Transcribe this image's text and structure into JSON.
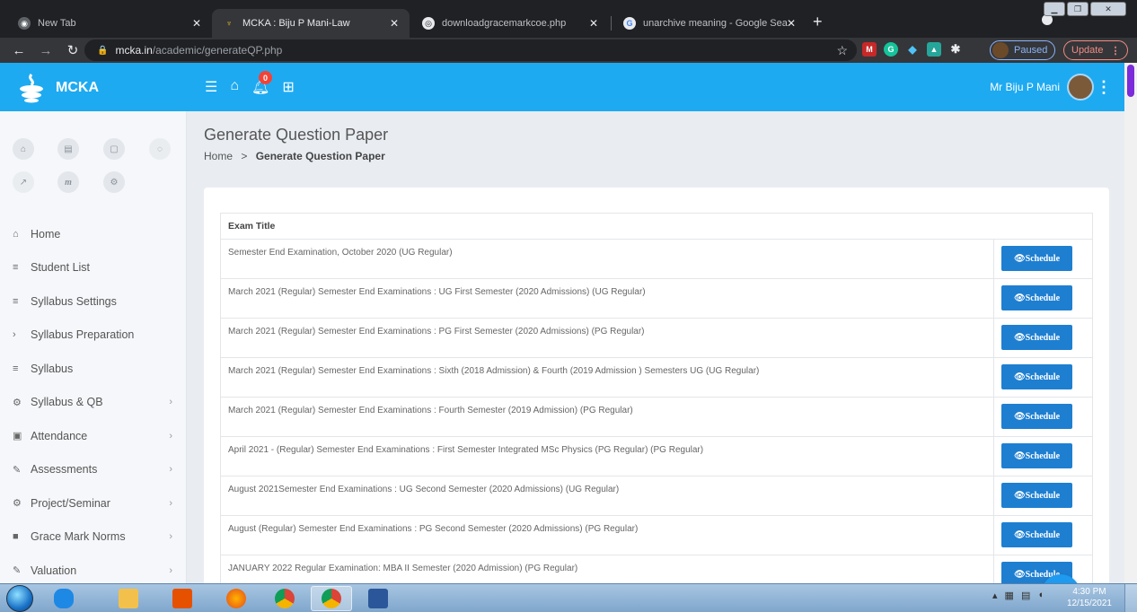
{
  "browser": {
    "tabs": [
      {
        "title": "New Tab",
        "favicon": "chrome-icon"
      },
      {
        "title": "MCKA : Biju P Mani-Law",
        "favicon": "mcka-logo-icon"
      },
      {
        "title": "downloadgracemarkcoe.php",
        "favicon": "globe-icon"
      },
      {
        "title": "unarchive meaning - Google Sea",
        "favicon": "google-icon"
      }
    ],
    "new_tab_label": "+",
    "url_host": "mcka.in",
    "url_path": "/academic/generateQP.php",
    "profile_label": "Paused",
    "update_label": "Update"
  },
  "header": {
    "brand": "MCKA",
    "notification_count": "0",
    "user_name": "Mr Biju P Mani"
  },
  "sidebar": {
    "menu": [
      {
        "label": "Home",
        "icon": "home-icon",
        "glyph": "⌂",
        "chevron": false
      },
      {
        "label": "Student List",
        "icon": "list-icon",
        "glyph": "≡",
        "chevron": false
      },
      {
        "label": "Syllabus Settings",
        "icon": "list-icon",
        "glyph": "≡",
        "chevron": false
      },
      {
        "label": "Syllabus Preparation",
        "icon": "chevron-right-icon",
        "glyph": "›",
        "chevron": false
      },
      {
        "label": "Syllabus",
        "icon": "list-icon",
        "glyph": "≡",
        "chevron": false
      },
      {
        "label": "Syllabus & QB",
        "icon": "cogs-icon",
        "glyph": "⚙",
        "chevron": true
      },
      {
        "label": "Attendance",
        "icon": "calendar-icon",
        "glyph": "▣",
        "chevron": true
      },
      {
        "label": "Assessments",
        "icon": "pencil-icon",
        "glyph": "✎",
        "chevron": true
      },
      {
        "label": "Project/Seminar",
        "icon": "cogs-icon",
        "glyph": "⚙",
        "chevron": true
      },
      {
        "label": "Grace Mark Norms",
        "icon": "book-icon",
        "glyph": "■",
        "chevron": true
      },
      {
        "label": "Valuation",
        "icon": "pencil-icon",
        "glyph": "✎",
        "chevron": true
      }
    ]
  },
  "page": {
    "title": "Generate Question Paper",
    "breadcrumb_home": "Home",
    "breadcrumb_sep": ">",
    "breadcrumb_current": "Generate Question Paper"
  },
  "table": {
    "header": "Exam Title",
    "button_label": "👁Schedule",
    "rows": [
      "Semester End Examination, October 2020 (UG Regular)",
      "March 2021 (Regular) Semester End Examinations : UG First Semester (2020 Admissions) (UG Regular)",
      "March 2021 (Regular) Semester End Examinations : PG First Semester (2020 Admissions) (PG Regular)",
      "March 2021 (Regular) Semester End Examinations : Sixth (2018 Admission) & Fourth (2019 Admission ) Semesters UG (UG Regular)",
      "March 2021 (Regular) Semester End Examinations : Fourth Semester (2019 Admission) (PG Regular)",
      "April 2021 - (Regular) Semester End Examinations : First Semester Integrated MSc Physics (PG Regular) (PG Regular)",
      "August 2021Semester End Examinations : UG Second Semester (2020 Admissions) (UG Regular)",
      "August (Regular) Semester End Examinations : PG Second Semester (2020 Admissions) (PG Regular)",
      "JANUARY 2022 Regular Examination: MBA II Semester (2020 Admission) (PG Regular)"
    ]
  },
  "taskbar": {
    "time": "4:30 PM",
    "date": "12/15/2021"
  },
  "colors": {
    "header_bg": "#1eaaf1",
    "button_bg": "#1e7fd1",
    "badge": "#f44236"
  }
}
